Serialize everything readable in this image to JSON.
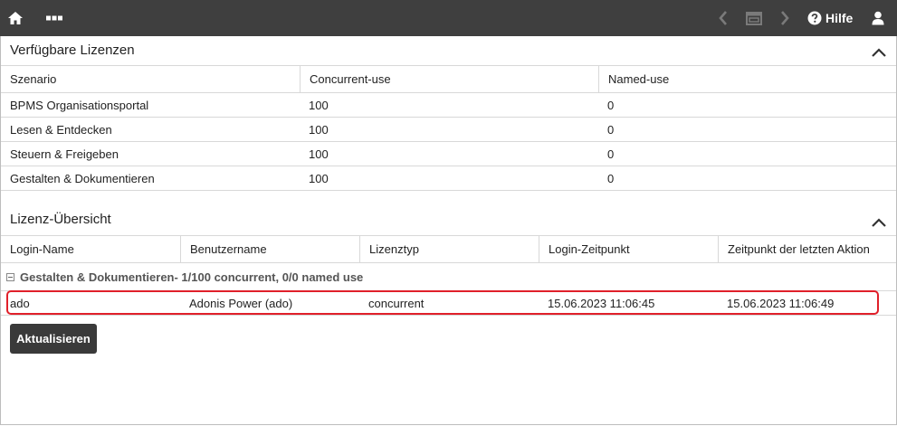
{
  "topbar": {
    "home_icon": "home-icon",
    "menu_icon": "more-dots-icon",
    "back_icon": "chevron-left-icon",
    "window_icon": "window-icon",
    "forward_icon": "chevron-right-icon",
    "help_icon": "help-circle-icon",
    "help_label": "Hilfe",
    "user_icon": "user-icon",
    "background": "#3f3f3f"
  },
  "licenses": {
    "title": "Verfügbare Lizenzen",
    "columns": [
      "Szenario",
      "Concurrent-use",
      "Named-use"
    ],
    "rows": [
      [
        "BPMS Organisationsportal",
        "100",
        "0"
      ],
      [
        "Lesen & Entdecken",
        "100",
        "0"
      ],
      [
        "Steuern & Freigeben",
        "100",
        "0"
      ],
      [
        "Gestalten & Dokumentieren",
        "100",
        "0"
      ]
    ]
  },
  "overview": {
    "title": "Lizenz-Übersicht",
    "columns": [
      "Login-Name",
      "Benutzername",
      "Lizenztyp",
      "Login-Zeitpunkt",
      "Zeitpunkt der letzten Aktion"
    ],
    "group_label": "Gestalten & Dokumentieren- 1/100 concurrent, 0/0 named use",
    "rows": [
      [
        "ado",
        "Adonis Power (ado)",
        "concurrent",
        "15.06.2023 11:06:45",
        "15.06.2023 11:06:49"
      ]
    ],
    "highlight_color": "#e0202a"
  },
  "refresh_button": {
    "label": "Aktualisieren"
  }
}
